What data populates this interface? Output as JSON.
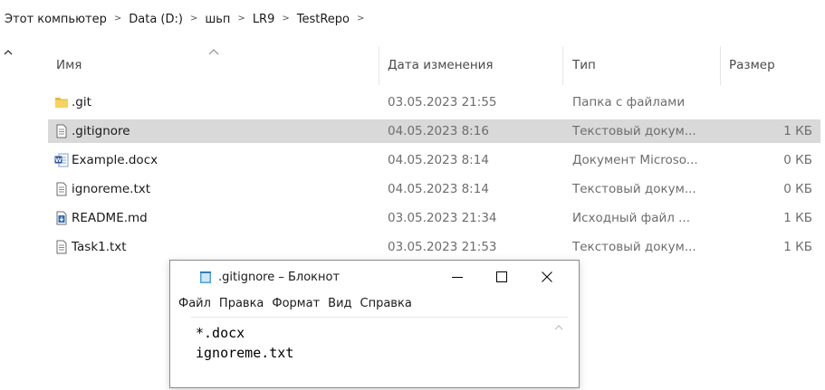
{
  "breadcrumb": [
    {
      "label": "Этот компьютер"
    },
    {
      "label": "Data (D:)"
    },
    {
      "label": "шьп"
    },
    {
      "label": "LR9"
    },
    {
      "label": "TestRepo"
    }
  ],
  "breadcrumb_separator": ">",
  "columns": {
    "name": "Имя",
    "date": "Дата изменения",
    "type": "Тип",
    "size": "Размер"
  },
  "files": [
    {
      "name": ".git",
      "date": "03.05.2023 21:55",
      "type": "Папка с файлами",
      "size": "",
      "icon": "folder-icon",
      "selected": false
    },
    {
      "name": ".gitignore",
      "date": "04.05.2023 8:16",
      "type": "Текстовый докум...",
      "size": "1 КБ",
      "icon": "text-file-icon",
      "selected": true
    },
    {
      "name": "Example.docx",
      "date": "04.05.2023 8:14",
      "type": "Документ Microso...",
      "size": "0 КБ",
      "icon": "word-document-icon",
      "selected": false
    },
    {
      "name": "ignoreme.txt",
      "date": "04.05.2023 8:14",
      "type": "Текстовый докум...",
      "size": "0 КБ",
      "icon": "text-file-icon",
      "selected": false
    },
    {
      "name": "README.md",
      "date": "03.05.2023 21:34",
      "type": "Исходный файл ...",
      "size": "1 КБ",
      "icon": "markdown-file-icon",
      "selected": false
    },
    {
      "name": "Task1.txt",
      "date": "03.05.2023 21:53",
      "type": "Текстовый докум...",
      "size": "1 КБ",
      "icon": "text-file-icon",
      "selected": false
    }
  ],
  "notepad": {
    "title": ".gitignore – Блокнот",
    "menu": [
      "Файл",
      "Правка",
      "Формат",
      "Вид",
      "Справка"
    ],
    "content": "*.docx\nignoreme.txt"
  },
  "colors": {
    "selection": "#d9d9d9",
    "folder": "#f4c542",
    "word_blue": "#2b579a",
    "markdown_blue": "#2a6ab8"
  }
}
